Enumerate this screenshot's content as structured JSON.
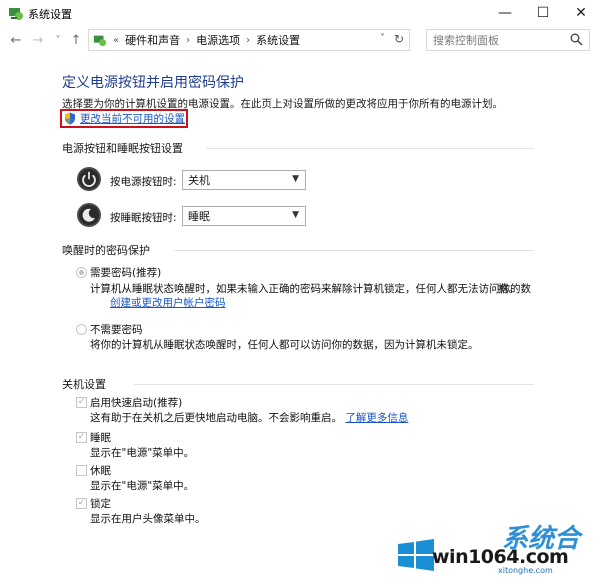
{
  "window": {
    "title": "系统设置",
    "minimize_glyph": "—",
    "maximize_glyph": "☐",
    "close_glyph": "✕"
  },
  "nav": {
    "back_glyph": "←",
    "forward_glyph": "→",
    "recent_glyph": "˅",
    "up_glyph": "↑"
  },
  "address": {
    "overflow": "«",
    "crumbs": [
      "硬件和声音",
      "电源选项",
      "系统设置"
    ],
    "separator": "›"
  },
  "search": {
    "placeholder": "搜索控制面板"
  },
  "page": {
    "title": "定义电源按钮并启用密码保护",
    "subtitle": "选择要为你的计算机设置的电源设置。在此页上对设置所做的更改将应用于你所有的电源计划。",
    "change_link": "更改当前不可用的设置"
  },
  "power_buttons": {
    "heading": "电源按钮和睡眠按钮设置",
    "power_label": "按电源按钮时:",
    "power_value": "关机",
    "sleep_label": "按睡眠按钮时:",
    "sleep_value": "睡眠"
  },
  "wake_password": {
    "heading": "唤醒时的密码保护",
    "require_label": "需要密码(推荐)",
    "require_desc": "计算机从睡眠状态唤醒时，如果未输入正确的密码来解除计算机锁定，任何人都无法访问你的数",
    "require_desc2": "据。",
    "require_link": "创建或更改用户帐户密码",
    "norequire_label": "不需要密码",
    "norequire_desc": "将你的计算机从睡眠状态唤醒时，任何人都可以访问你的数据，因为计算机未锁定。"
  },
  "shutdown": {
    "heading": "关机设置",
    "items": [
      {
        "label": "启用快速启动(推荐)",
        "desc": "这有助于在关机之后更快地启动电脑。不会影响重启。",
        "link": "了解更多信息",
        "checked": true
      },
      {
        "label": "睡眠",
        "desc": "显示在\"电源\"菜单中。",
        "checked": true
      },
      {
        "label": "休眠",
        "desc": "显示在\"电源\"菜单中。",
        "checked": false
      },
      {
        "label": "锁定",
        "desc": "显示在用户头像菜单中。",
        "checked": true
      }
    ],
    "check_glyph": "✓"
  },
  "watermark": {
    "brand": "系统合",
    "site": "win1064.com",
    "url": "xitonghe.com"
  },
  "colors": {
    "title_blue": "#1e3d8f",
    "link_blue": "#1a56c9",
    "highlight_red": "#d0101c"
  }
}
